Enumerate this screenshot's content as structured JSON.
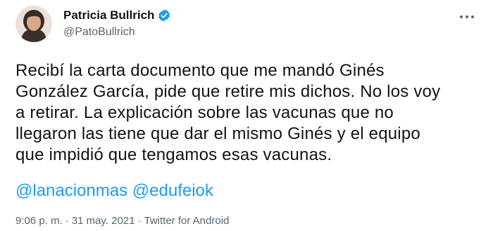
{
  "author": {
    "name": "Patricia Bullrich",
    "handle": "@PatoBullrich",
    "verified": true,
    "avatar_icon": "profile-photo"
  },
  "tweet": {
    "lines": [
      "Recibí la carta documento que me mandó Ginés",
      "González García, pide que retire mis dichos. No los voy",
      "a retirar. La explicación sobre las vacunas que no",
      "llegaron las tiene que dar el mismo Ginés y el equipo",
      "que impidió que tengamos esas vacunas."
    ],
    "mentions": [
      "@lanacionmas",
      "@edufeiok"
    ]
  },
  "meta": {
    "time": "9:06 p. m.",
    "separator": "·",
    "date": "31 may. 2021",
    "source": "Twitter for Android"
  },
  "colors": {
    "link": "#1d9bf0",
    "text": "#0f1419",
    "secondary": "#536471"
  },
  "icons": {
    "more": "more-dots-icon",
    "verified": "verified-badge-icon"
  }
}
